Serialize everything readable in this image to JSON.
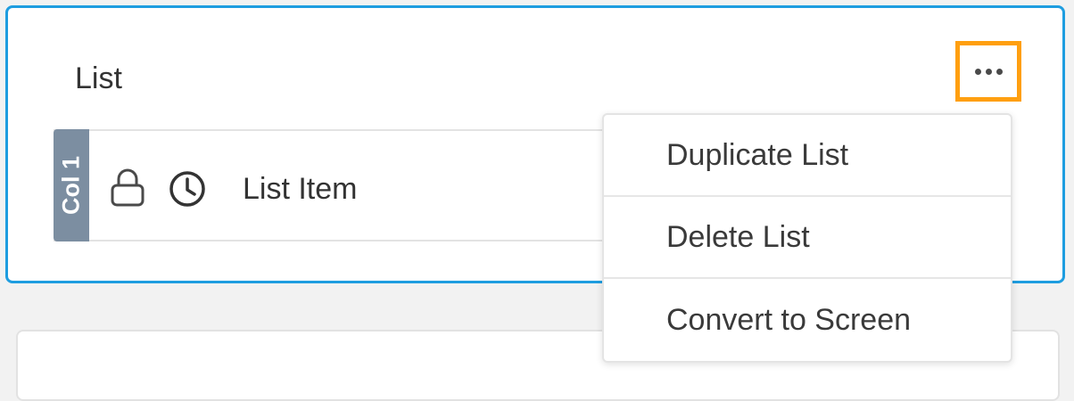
{
  "list": {
    "title": "List",
    "column_tab": "Col 1",
    "item_label": "List Item"
  },
  "menu": {
    "items": [
      {
        "label": "Duplicate List"
      },
      {
        "label": "Delete List"
      },
      {
        "label": "Convert to Screen"
      }
    ]
  },
  "icons": {
    "more": "more-horizontal-icon",
    "lock": "lock-icon",
    "clock": "clock-icon"
  },
  "colors": {
    "selected_border": "#1e9de0",
    "highlight": "#ff9f0f",
    "column_tab": "#7c8ea1"
  }
}
